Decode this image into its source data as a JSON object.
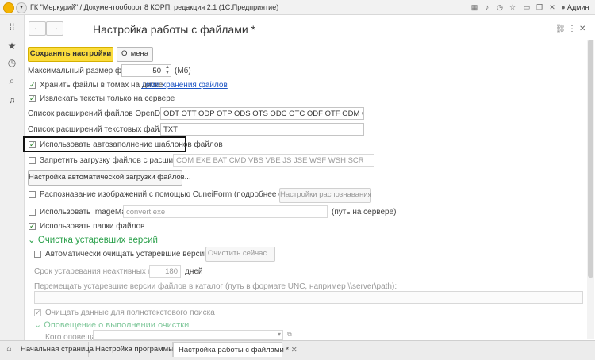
{
  "window": {
    "title": "ГК \"Меркурий\" / Документооборот 8 КОРП, редакция 2.1  (1С:Предприятие)",
    "user": "Админ",
    "toolbar_icons": [
      "grid-icon",
      "bell-icon",
      "history-icon",
      "star-icon",
      "minimize-icon",
      "restore-icon",
      "close-icon"
    ]
  },
  "rail": {
    "icons": [
      "apps-icon",
      "star-icon",
      "history-icon",
      "search-icon",
      "bell-icon"
    ]
  },
  "form": {
    "back": "←",
    "forward": "→",
    "title": "Настройка работы с файлами *",
    "save_label": "Сохранить настройки",
    "cancel_label": "Отмена",
    "max_size_label": "Максимальный размер файла:",
    "max_size_value": "50",
    "max_size_unit": "(Мб)",
    "store_in_volumes_label": "Хранить файлы в томах на диске",
    "volumes_link": "Тома хранения файлов",
    "extract_text_label": "Извлекать тексты только на сервере",
    "opendoc_label": "Список расширений файлов OpenDocument:",
    "opendoc_value": "ODT OTT ODP OTP ODS OTS ODC OTC ODF OTF ODM OTH SDW",
    "text_ext_label": "Список расширений текстовых файлов:",
    "text_ext_value": "TXT",
    "autofill_label": "Использовать автозаполнение шаблонов файлов",
    "forbid_label": "Запретить загрузку файлов с расширением:",
    "forbid_value": "COM EXE BAT CMD VBS VBE JS JSE WSF WSH SCR",
    "autoload_button": "Настройка автоматической загрузки файлов...",
    "cuneiform_label": "Распознавание изображений с помощью CuneiForm (подробнее см. в справке)",
    "recognition_button": "Настройки распознавания",
    "imagemagick_label": "Использовать ImageMagick",
    "imagemagick_value": "convert.exe",
    "imagemagick_note": "(путь на сервере)",
    "folders_label": "Использовать папки файлов",
    "cleanup_section": "Очистка устаревших версий",
    "auto_cleanup_label": "Автоматически очищать устаревшие версии файлов",
    "cleanup_now_button": "Очистить сейчас...",
    "obsolete_term_label": "Срок устаревания неактивных версий:",
    "obsolete_term_value": "180",
    "obsolete_term_unit": "дней",
    "move_label": "Перемещать устаревшие версии файлов в каталог (путь в формате UNC, например \\\\server\\path):",
    "fulltext_label": "Очищать данные для полнотекстового поиска",
    "notify_section": "Оповещение о выполнении очистки",
    "notify_who_label": "Кого оповещать:"
  },
  "tabs": {
    "home": "Начальная страница",
    "program": "Настройка программы",
    "files": "Настройка работы с файлами *"
  }
}
